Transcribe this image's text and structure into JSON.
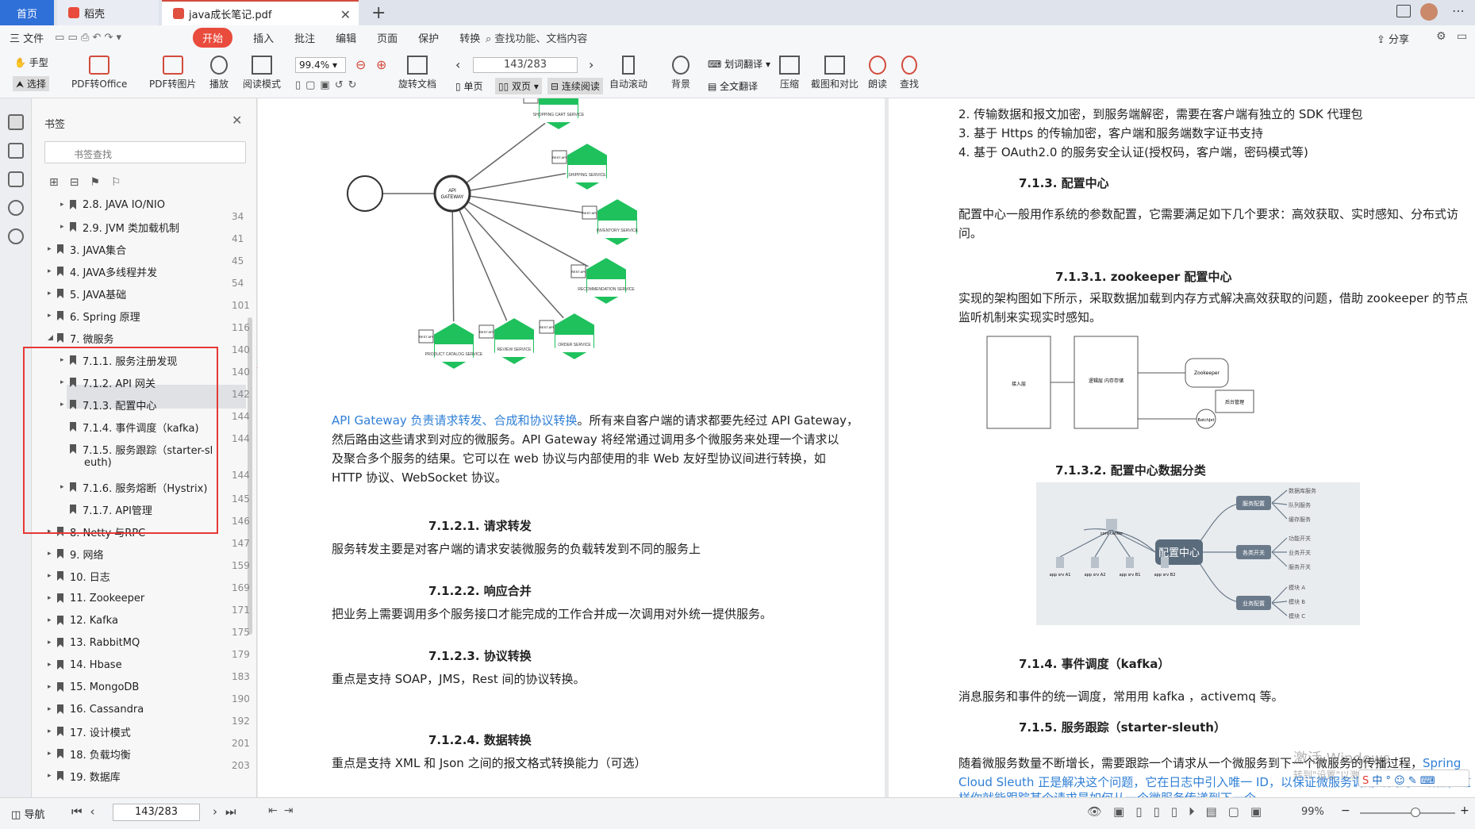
{
  "tabs": {
    "home": "首页",
    "wps": "稻壳",
    "file": "java成长笔记.pdf",
    "add": "+"
  },
  "menu": {
    "file": "三 文件",
    "items": [
      "开始",
      "插入",
      "批注",
      "编辑",
      "页面",
      "保护",
      "转换"
    ],
    "active": "开始",
    "search": "查找功能、文档内容",
    "share": "分享"
  },
  "toolbar": {
    "hand": "手型",
    "select": "选择",
    "pdf_to_office": "PDF转Office",
    "pdf_to_image": "PDF转图片",
    "play": "播放",
    "read_mode": "阅读模式",
    "zoom": "99.4%",
    "rotate": "旋转文档",
    "page_input": "143/283",
    "single": "单页",
    "double": "双页",
    "continuous": "连续阅读",
    "auto_scroll": "自动滚动",
    "background": "背景",
    "word_translate": "划词翻译",
    "full_translate": "全文翻译",
    "compress": "压缩",
    "screenshot": "截图和对比",
    "read_aloud": "朗读",
    "find": "查找"
  },
  "bookmarks": {
    "title": "书签",
    "search_placeholder": "书签查找",
    "items": [
      {
        "label": "2.8.  JAVA IO/NIO",
        "page": "34"
      },
      {
        "label": "2.9. JVM 类加载机制",
        "page": "41"
      },
      {
        "label": "3. JAVA集合",
        "page": "45"
      },
      {
        "label": "4. JAVA多线程并发",
        "page": "54"
      },
      {
        "label": "5. JAVA基础",
        "page": "101"
      },
      {
        "label": "6. Spring 原理",
        "page": "116"
      },
      {
        "label": "7.   微服务",
        "page": "140"
      },
      {
        "label": "7.1.1. 服务注册发现",
        "page": "140"
      },
      {
        "label": "7.1.2. API 网关",
        "page": "142"
      },
      {
        "label": "7.1.3. 配置中心",
        "page": "144"
      },
      {
        "label": "7.1.4. 事件调度（kafka)",
        "page": "144"
      },
      {
        "label": "7.1.5. 服务跟踪（starter-sl",
        "label2": "euth)",
        "page": "144"
      },
      {
        "label": "7.1.6. 服务熔断（Hystrix)",
        "page": "145"
      },
      {
        "label": "7.1.7. API管理",
        "page": "146"
      },
      {
        "label": "8. Netty 与RPC",
        "page": "147"
      },
      {
        "label": "9. 网络",
        "page": "159"
      },
      {
        "label": "10. 日志",
        "page": "169"
      },
      {
        "label": "11. Zookeeper",
        "page": "171"
      },
      {
        "label": "12. Kafka",
        "page": "175"
      },
      {
        "label": "13. RabbitMQ",
        "page": "179"
      },
      {
        "label": "14. Hbase",
        "page": "183"
      },
      {
        "label": "15. MongoDB",
        "page": "190"
      },
      {
        "label": "16. Cassandra",
        "page": "192"
      },
      {
        "label": "17. 设计模式",
        "page": "201"
      },
      {
        "label": "18. 负载均衡",
        "page": "203"
      },
      {
        "label": "19. 数据库",
        "page": ""
      }
    ]
  },
  "diagram": {
    "center": "API GATEWAY",
    "rest": "REST API",
    "services": [
      "SHOPPING CART SERVICE",
      "SHIPPING SERVICE",
      "INVENTORY SERVICE",
      "RECOMMENDATION SERVICE",
      "ORDER SERVICE",
      "REVIEW SERVICE",
      "PRODUCT CATALOG SERVICE"
    ]
  },
  "page_left": {
    "intro_blue": "API Gateway 负责请求转发、合成和协议转换",
    "intro_rest": "。所有来自客户端的请求都要先经过 API Gateway，",
    "intro2": "然后路由这些请求到对应的微服务。API Gateway 将经常通过调用多个微服务来处理一个请求以",
    "intro3": "及聚合多个服务的结果。它可以在 web 协议与内部使用的非 Web 友好型协议间进行转换，如",
    "intro4": "HTTP 协议、WebSocket 协议。",
    "h1": "7.1.2.1.     请求转发",
    "p1": "服务转发主要是对客户端的请求安装微服务的负载转发到不同的服务上",
    "h2": "7.1.2.2.     响应合并",
    "p2": "把业务上需要调用多个服务接口才能完成的工作合并成一次调用对外统一提供服务。",
    "h3": "7.1.2.3.     协议转换",
    "p3": "重点是支持 SOAP，JMS，Rest 间的协议转换。",
    "h4": "7.1.2.4.     数据转换",
    "p4": "重点是支持 XML 和 Json 之间的报文格式转换能力（可选）"
  },
  "page_right": {
    "l2": "2.   传输数据和报文加密，到服务端解密，需要在客户端有独立的 SDK 代理包",
    "l3": "3.   基于 Https 的传输加密，客户端和服务端数字证书支持",
    "l4": "4.   基于 OAuth2.0 的服务安全认证(授权码，客户端，密码模式等)",
    "h_config": "7.1.3.  配置中心",
    "p_config": "配置中心一般用作系统的参数配置，它需要满足如下几个要求：高效获取、实时感知、分布式访",
    "p_config2": "问。",
    "h_zk": "7.1.3.1.      zookeeper 配置中心",
    "p_zk": "实现的架构图如下所示，采取数据加载到内存方式解决高效获取的问题，借助 zookeeper 的节点",
    "p_zk2": "监听机制来实现实时感知。",
    "zk_boxes": [
      "接入层",
      "逻辑层\n内存存储",
      "Zookeeper",
      "BatchJet",
      "后台管理"
    ],
    "h_cls": "7.1.3.2.      配置中心数据分类",
    "mind_center": "配置中心",
    "mind_top": "conf center",
    "mind_apps": [
      "app srv A1",
      "app srv A2",
      "app srv B1",
      "app srv B2"
    ],
    "mind_branches": [
      "服务配置",
      "各类开关",
      "业务配置"
    ],
    "mind_leaves": [
      "数据库服务",
      "队列服务",
      "缓存服务",
      "功能开关",
      "业务开关",
      "服务开关",
      "模块 A",
      "模块 B",
      "模块 C"
    ],
    "h_kafka": "7.1.4.  事件调度（kafka）",
    "p_kafka": "消息服务和事件的统一调度，常用用 kafka ，activemq 等。",
    "h_sleuth": "7.1.5.  服务跟踪（starter-sleuth）",
    "p_sleuth1": " 随着微服务数量不断增长，需要跟踪一个请求从一个微服务到下一个微服务的传播过程，",
    "p_sleuth1b": "Spring",
    "p_sleuth2": "Cloud Sleuth 正是解决这个问题，它在日志中引入唯一 ID，以保证微服务调用之间的一致性，这",
    "p_sleuth3": "样你就能跟踪某个请求是如何从一个微服务传递到下一个",
    "watermark1": "激活 Windows",
    "watermark2": "转到\"设置\"以激活 Windows。"
  },
  "statusbar": {
    "nav": "导航",
    "page": "143/283",
    "zoom": "99%"
  },
  "colors": {
    "accent": "#e94b3c",
    "blue_tab": "#2f6fd8",
    "green": "#1fc15d",
    "link": "#2f7fd6"
  }
}
